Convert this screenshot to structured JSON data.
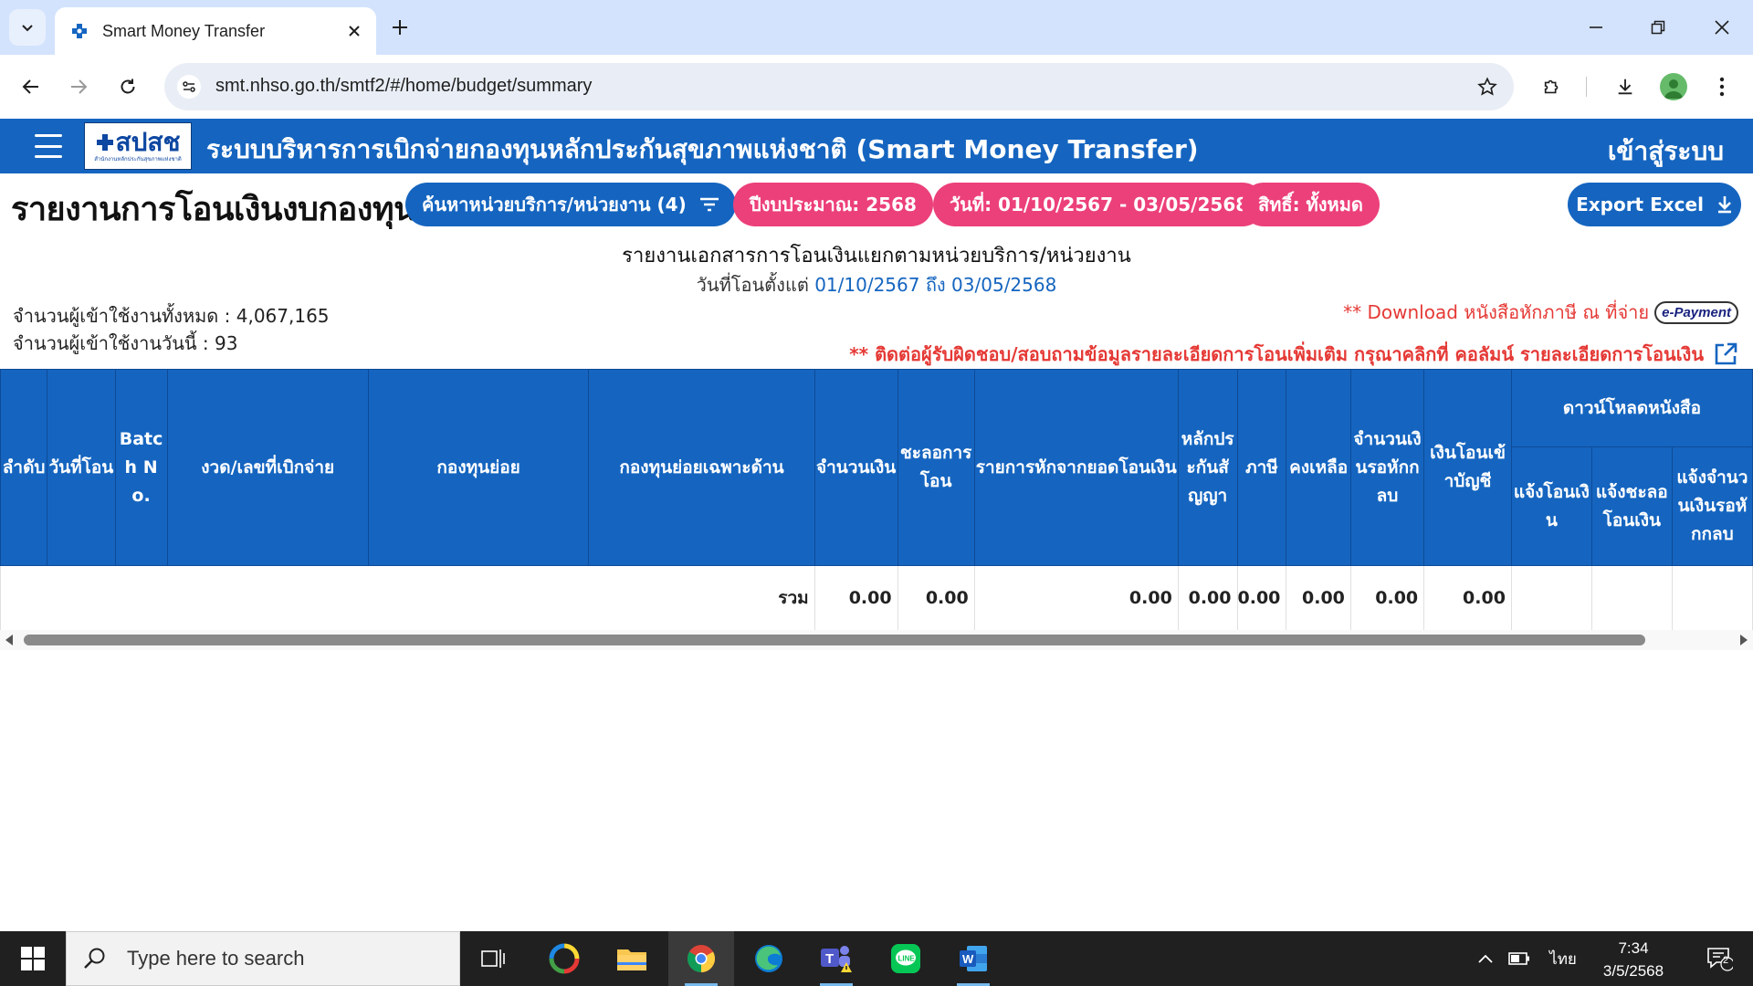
{
  "browser": {
    "tab_title": "Smart Money Transfer",
    "url": "smt.nhso.go.th/smtf2/#/home/budget/summary"
  },
  "header": {
    "logo_text": "สปสช",
    "logo_subtext": "สำนักงานหลักประกันสุขภาพแห่งชาติ",
    "title": "ระบบบริหารการเบิกจ่ายกองทุนหลักประกันสุขภาพแห่งชาติ (Smart Money Transfer)",
    "login_label": "เข้าสู่ระบบ"
  },
  "filters": {
    "page_title": "รายงานการโอนเงินงบกองทุน",
    "search_unit": "ค้นหาหน่วยบริการ/หน่วยงาน (4)",
    "fiscal_year": "ปีงบประมาณ: 2568",
    "date_range": "วันที่: 01/10/2567 - 03/05/2568",
    "rights": "สิทธิ์: ทั้งหมด",
    "export_label": "Export Excel"
  },
  "report": {
    "title": "รายงานเอกสารการโอนเงินแยกตามหน่วยบริการ/หน่วยงาน",
    "sub_prefix": "วันที่โอนตั้งแต่",
    "sub_dates": "01/10/2567 ถึง 03/05/2568",
    "users_total": "จำนวนผู้เข้าใช้งานทั้งหมด : 4,067,165",
    "users_today": "จำนวนผู้เข้าใช้งานวันนี้ : 93",
    "download_note": "** Download หนังสือหักภาษี ณ ที่จ่าย",
    "epayment_label": "e-Payment",
    "contact_note": "** ติดต่อผู้รับผิดชอบ/สอบถามข้อมูลรายละเอียดการโอนเพิ่มเติม กรุณาคลิกที่ คอลัมน์ รายละเอียดการโอนเงิน"
  },
  "table": {
    "headers": {
      "seq": "ลำดับ",
      "transfer_date": "วันที่โอน",
      "batch": "Batch No.",
      "period": "งวด/เลขที่เบิกจ่าย",
      "subfund": "กองทุนย่อย",
      "subfund_specific": "กองทุนย่อยเฉพาะด้าน",
      "amount": "จำนวนเงิน",
      "delay": "ชะลอการโอน",
      "deduct": "รายการหักจากยอดโอนเงิน",
      "guarantee": "หลักประกันสัญญา",
      "tax": "ภาษี",
      "remaining": "คงเหลือ",
      "pending_deduct": "จำนวนเงินรอหักกลบ",
      "to_account": "เงินโอนเข้าบัญชี",
      "download_group": "ดาวน์โหลดหนังสือ",
      "notify_transfer": "แจ้งโอนเงิน",
      "notify_delay": "แจ้งชะลอโอนเงิน",
      "notify_amount": "แจ้งจำนวนเงินรอหักกลบ"
    },
    "total_label": "รวม",
    "totals": {
      "amount": "0.00",
      "delay": "0.00",
      "deduct": "0.00",
      "guarantee": "0.00",
      "tax": "0.00",
      "remaining": "0.00",
      "pending_deduct": "0.00",
      "to_account": "0.00"
    }
  },
  "taskbar": {
    "search_placeholder": "Type here to search",
    "language": "ไทย",
    "time": "7:34",
    "date": "3/5/2568",
    "notification_count": "2"
  },
  "colors": {
    "primary": "#1565c0",
    "pink": "#ec407a",
    "alert": "#e53935"
  }
}
